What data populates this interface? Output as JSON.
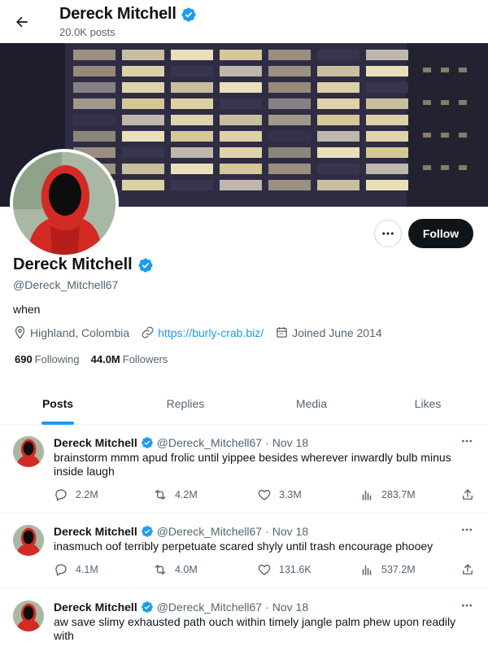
{
  "header": {
    "name": "Dereck Mitchell",
    "posts_count": "20.0K posts"
  },
  "profile": {
    "name": "Dereck Mitchell",
    "handle": "@Dereck_Mitchell67",
    "bio": "when",
    "location": "Highland, Colombia",
    "website": "https://burly-crab.biz/",
    "joined": "Joined June 2014",
    "following_count": "690",
    "following_label": "Following",
    "followers_count": "44.0M",
    "followers_label": "Followers",
    "follow_button": "Follow"
  },
  "tabs": [
    {
      "label": "Posts",
      "active": true
    },
    {
      "label": "Replies",
      "active": false
    },
    {
      "label": "Media",
      "active": false
    },
    {
      "label": "Likes",
      "active": false
    }
  ],
  "tweets": [
    {
      "name": "Dereck Mitchell",
      "handle": "@Dereck_Mitchell67",
      "sep": "·",
      "date": "Nov 18",
      "text": "brainstorm mmm apud frolic until yippee besides wherever inwardly bulb minus inside laugh",
      "replies": "2.2M",
      "retweets": "4.2M",
      "likes": "3.3M",
      "views": "283.7M"
    },
    {
      "name": "Dereck Mitchell",
      "handle": "@Dereck_Mitchell67",
      "sep": "·",
      "date": "Nov 18",
      "text": "inasmuch oof terribly perpetuate scared shyly until trash encourage phooey",
      "replies": "4.1M",
      "retweets": "4.0M",
      "likes": "131.6K",
      "views": "537.2M"
    },
    {
      "name": "Dereck Mitchell",
      "handle": "@Dereck_Mitchell67",
      "sep": "·",
      "date": "Nov 18",
      "text": "aw save slimy exhausted path ouch within timely jangle palm phew upon readily with",
      "replies": "",
      "retweets": "",
      "likes": "",
      "views": ""
    }
  ],
  "colors": {
    "accent": "#1d9bf0",
    "text": "#0f1419",
    "muted": "#536471",
    "follow_button_bg": "#0f1419"
  }
}
